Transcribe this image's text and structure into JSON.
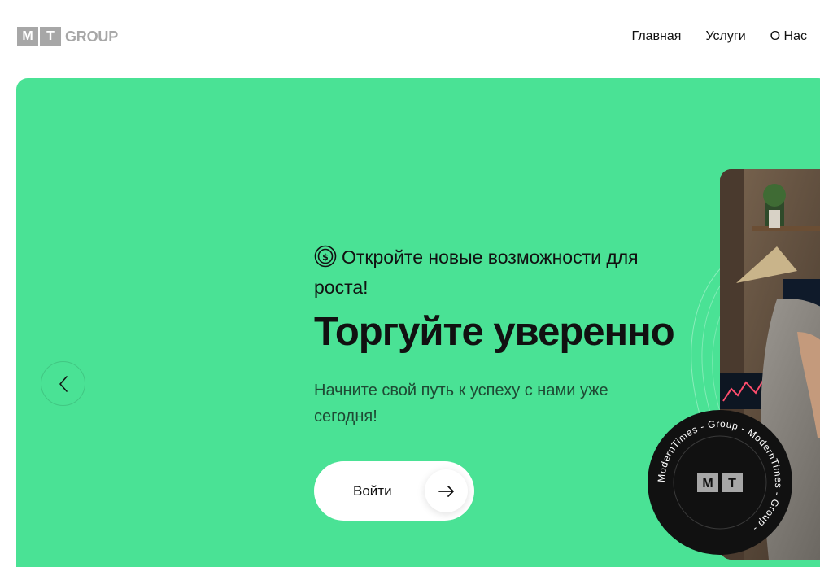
{
  "header": {
    "logo": {
      "letter1": "M",
      "letter2": "T",
      "text": "GROUP"
    },
    "nav": [
      {
        "label": "Главная"
      },
      {
        "label": "Услуги"
      },
      {
        "label": "О Нас"
      }
    ]
  },
  "hero": {
    "tagline_icon": "dollar-coin-icon",
    "tagline": "Откройте новые возможности для роста!",
    "title": "Торгуйте уверенно",
    "subtitle": "Начните свой путь к успеху с нами уже сегодня!",
    "cta_label": "Войти",
    "prev_icon": "chevron-left-icon",
    "cta_icon": "arrow-right-icon"
  },
  "badge": {
    "ring_text": "ModernTimes - Group - ModernTimes - Group - ",
    "letter1": "M",
    "letter2": "T"
  },
  "colors": {
    "hero_bg": "#4ae295",
    "logo_gray": "#a7a7a7",
    "badge_bg": "#111111"
  }
}
